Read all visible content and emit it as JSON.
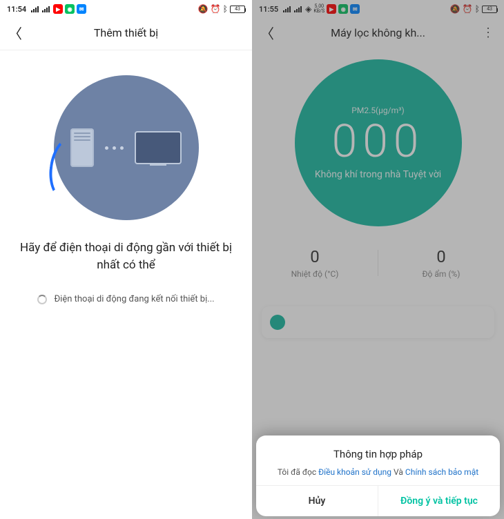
{
  "left": {
    "status": {
      "time": "11:54",
      "battery": "43"
    },
    "header": {
      "title": "Thêm thiết bị"
    },
    "message": "Hãy để điện thoại di động gần với thiết bị nhất có thể",
    "connecting": "Điện thoại di động đang kết nối thiết bị..."
  },
  "right": {
    "status": {
      "time": "11:55",
      "speed_top": "5.00",
      "speed_bot": "KB/S",
      "battery": "43"
    },
    "header": {
      "title": "Máy lọc không kh..."
    },
    "air": {
      "pm_label": "PM2.5(μg/m³)",
      "pm_value": "000",
      "quality": "Không khí trong nhà Tuyệt vời"
    },
    "metrics": {
      "temp_value": "0",
      "temp_label": "Nhiệt độ (°C)",
      "hum_value": "0",
      "hum_label": "Độ ẩm (%)"
    },
    "sheet": {
      "title": "Thông tin hợp pháp",
      "prefix": "Tôi đã đọc ",
      "terms": "Điều khoản sử dụng",
      "mid": " Và ",
      "privacy": "Chính sách bảo mật",
      "cancel": "Hủy",
      "agree": "Đồng ý và tiếp tục"
    }
  }
}
